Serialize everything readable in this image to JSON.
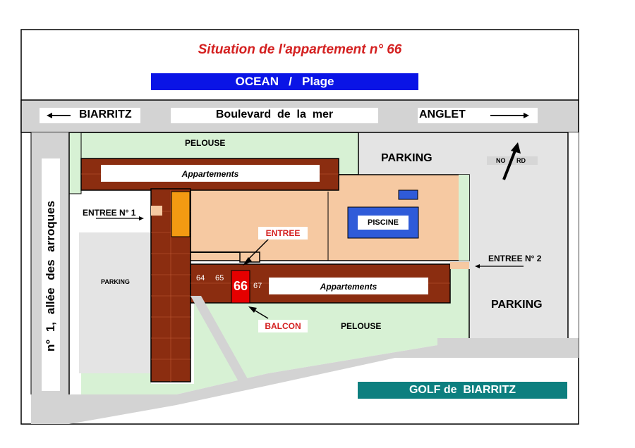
{
  "title": "Situation de l'appartement n° 66",
  "ocean": "OCEAN   /   Plage",
  "road": {
    "left": "BIARRITZ",
    "center": "Boulevard  de  la  mer",
    "right": "ANGLET"
  },
  "side_street": "n° 1, allée des arroques",
  "labels": {
    "pelouse_top": "PELOUSE",
    "pelouse_bottom": "PELOUSE",
    "parking_top": "PARKING",
    "parking_left": "PARKING",
    "parking_right": "PARKING",
    "north_left": "NO",
    "north_right": "RD",
    "appartements_top": "Appartements",
    "appartements_bottom": "Appartements",
    "entree1": "ENTREE N° 1",
    "entree2": "ENTREE N° 2",
    "entree": "ENTREE",
    "piscine": "PISCINE",
    "balcon": "BALCON",
    "apt64": "64",
    "apt65": "65",
    "apt66": "66",
    "apt67": "67",
    "golf": "GOLF de  BIARRITZ"
  },
  "colors": {
    "title": "#d42020",
    "ocean": "#0a14e6",
    "road": "#d3d3d3",
    "lawn": "#d7f1d4",
    "building": "#8b2d10",
    "courtyard": "#f6c9a2",
    "pool": "#2f5bd9",
    "highlight": "#e50000",
    "golf": "#0d7f7f",
    "orange": "#f39a12"
  }
}
